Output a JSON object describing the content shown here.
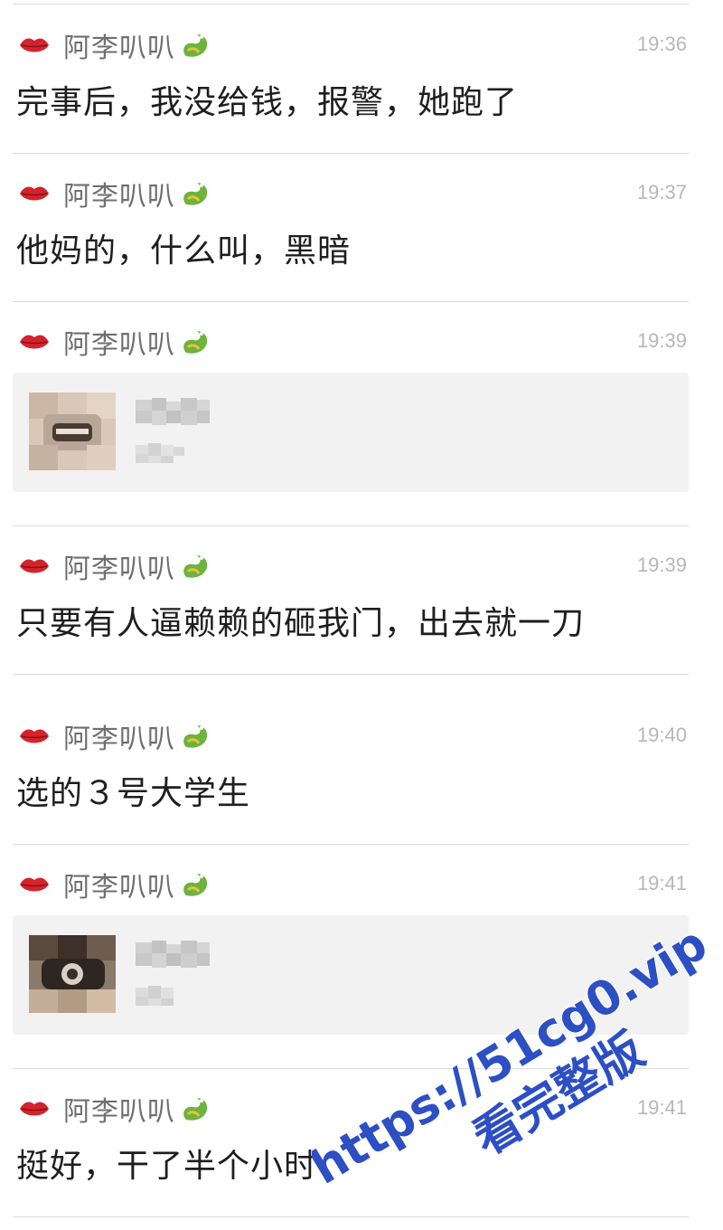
{
  "sender": "阿李叭叭",
  "colors": {
    "lips": "#d4232c",
    "dragon": "#6db33f",
    "watermark": "#2d4fc4"
  },
  "messages": [
    {
      "time": "19:36",
      "kind": "text",
      "text": "完事后，我没给钱，报警，她跑了"
    },
    {
      "time": "19:37",
      "kind": "text",
      "text": "他妈的，什么叫，黑暗"
    },
    {
      "time": "19:39",
      "kind": "card"
    },
    {
      "time": "19:39",
      "kind": "text",
      "text": "只要有人逼赖赖的砸我门，出去就一刀"
    },
    {
      "time": "19:40",
      "kind": "text",
      "text": "选的３号大学生"
    },
    {
      "time": "19:41",
      "kind": "card"
    },
    {
      "time": "19:41",
      "kind": "text",
      "text": "挺好，干了半个小时"
    }
  ],
  "watermark": {
    "line1": "https://51cg0.vip",
    "line2": "看完整版"
  }
}
